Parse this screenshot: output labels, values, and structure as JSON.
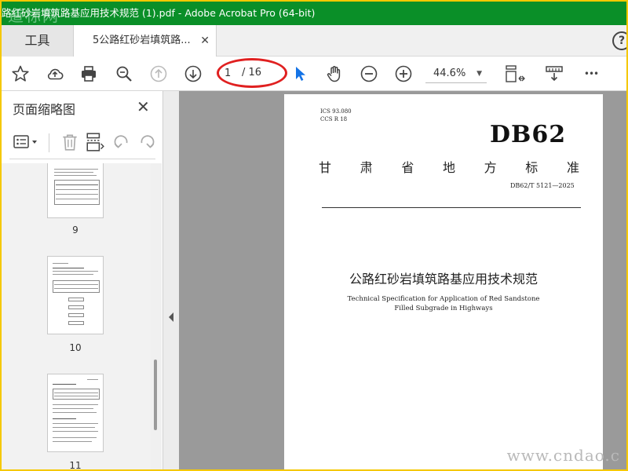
{
  "window": {
    "title": "路红砂岩填筑路基应用技术规范 (1).pdf - Adobe Acrobat Pro (64-bit)",
    "overlay_watermark": "道标网"
  },
  "tabs": {
    "tools_label": "工具",
    "doc_label": "5公路红砂岩填筑路...",
    "close_glyph": "✕",
    "help_glyph": "?"
  },
  "toolbar": {
    "icons": [
      "star-icon",
      "cloud-upload-icon",
      "print-icon",
      "zoom-search-icon",
      "page-up-icon",
      "page-down-icon",
      "select-arrow-icon",
      "hand-icon",
      "zoom-out-icon",
      "zoom-in-icon",
      "fit-page-icon",
      "scrolling-mode-icon",
      "more-icon"
    ],
    "page_current": "1",
    "page_total": "/ 16",
    "zoom_value": "44.6%",
    "more_glyph": "•••"
  },
  "panel": {
    "title": "页面缩略图",
    "close_glyph": "✕",
    "thumbnails": [
      {
        "label": "9"
      },
      {
        "label": "10"
      },
      {
        "label": "11"
      }
    ]
  },
  "document": {
    "ics": "ICS  93.080",
    "ccs": "CCS  R 18",
    "db_mark": "DB62",
    "province_chars": [
      "甘",
      "肃",
      "省",
      "地",
      "方",
      "标",
      "准"
    ],
    "code": "DB62/T  5121—2025",
    "title_cn": "公路红砂岩填筑路基应用技术规范",
    "title_en_line1": "Technical Specification for Application of Red Sandstone",
    "title_en_line2": "Filled Subgrade in Highways"
  },
  "watermark_text": "www.cndao.c",
  "colors": {
    "title_bar": "#0a8f28",
    "frame_border": "#f5c800",
    "highlight": "#e02020",
    "select_accent": "#1473e6"
  }
}
